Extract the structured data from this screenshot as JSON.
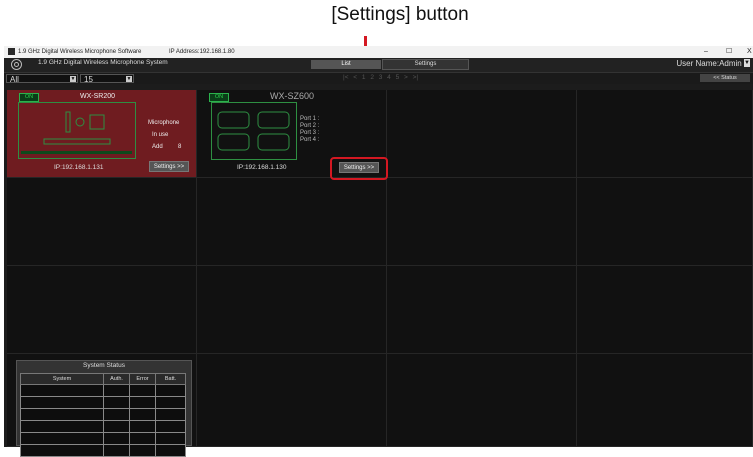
{
  "callout": {
    "label": "[Settings] button",
    "color": "#d41822"
  },
  "titlebar": {
    "title": "1.9 GHz Digital Wireless Microphone Software",
    "ip_address": "IP Address:192.168.1.80",
    "minimize": "–",
    "maximize": "☐",
    "close": "X"
  },
  "header": {
    "system_name": "1.9 GHz Digital Wireless Microphone System",
    "tabs": [
      {
        "label": "List",
        "active": true
      },
      {
        "label": "Settings",
        "active": false
      }
    ],
    "user": "User Name:Admin"
  },
  "toolbar": {
    "filter_value": "All",
    "count_value": "15",
    "pager": "|<  <  1  2  3  4  5  >  >|",
    "status_button": "<< Status"
  },
  "devices": [
    {
      "status": "ON",
      "name": "WX-SR200",
      "type_label": "Microphone",
      "in_use_label": "In use",
      "add_label": "Add",
      "add_value": "8",
      "ip": "IP:192.168.1.131",
      "settings_label": "Settings >>",
      "color": "#6f1c20"
    },
    {
      "status": "ON",
      "name": "WX-SZ600",
      "ports": [
        "Port 1 :",
        "Port 2 :",
        "Port 3 :",
        "Port 4 :"
      ],
      "ip": "IP:192.168.1.130",
      "settings_label": "Settings >>"
    }
  ],
  "system_status": {
    "title": "System Status",
    "columns": [
      "System",
      "Auth.",
      "Error",
      "Batt."
    ]
  }
}
